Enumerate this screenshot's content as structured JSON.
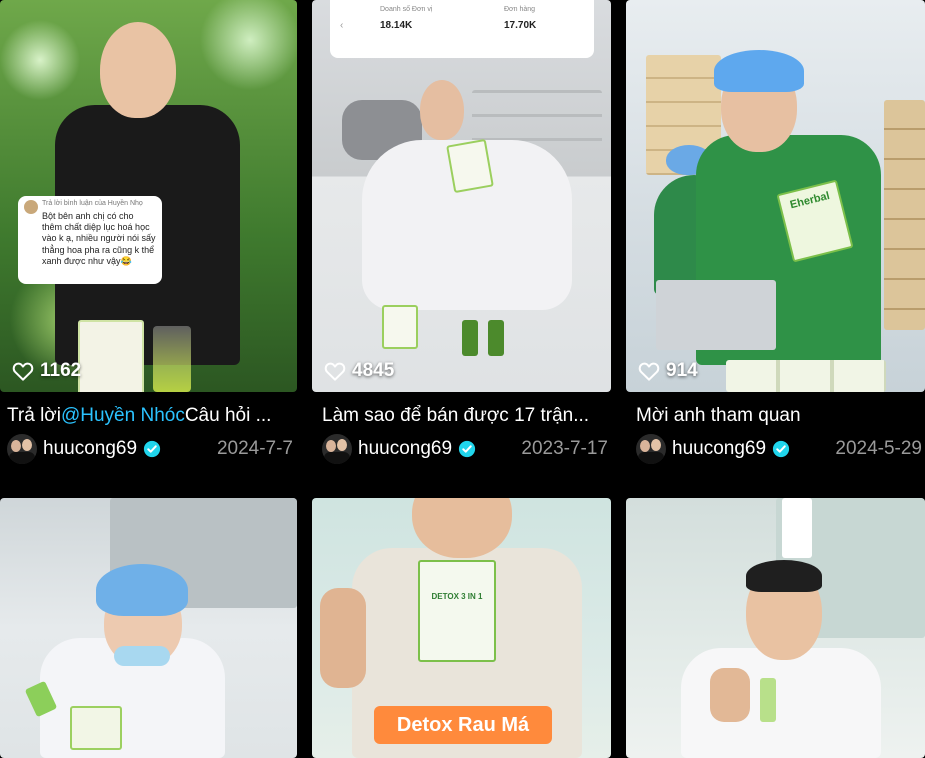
{
  "videos": [
    {
      "likes": "1162",
      "title_prefix": "Trả lời",
      "title_mention": "@Huyền Nhóc",
      "title_rest": "Câu hỏi ...",
      "author": "huucong69",
      "date": "2024-7-7",
      "overlay": {
        "header": "Trả lời bình luận của Huyền Nhọ",
        "text": "Bột bên anh chị có cho thêm chất diệp lục hoá học vào k ạ, nhiều người nói sấy thẳng hoa pha ra cũng k thể xanh được như vậy😂"
      }
    },
    {
      "likes": "4845",
      "title": "Làm sao để bán được 17 trận...",
      "author": "huucong69",
      "date": "2023-7-17",
      "overlay": {
        "label_1": "Doanh số Đơn vị",
        "value_1": "18.14K",
        "label_2": "Đơn hàng",
        "value_2": "17.70K",
        "arrow": "‹"
      }
    },
    {
      "likes": "914",
      "title": "Mời anh tham quan",
      "author": "huucong69",
      "date": "2024-5-29",
      "overlay": {
        "box_label": "Eherbal"
      }
    },
    {
      "overlay": {}
    },
    {
      "overlay": {
        "pill": "Detox Rau Má",
        "box_label": "DETOX 3 IN 1"
      }
    },
    {
      "overlay": {}
    }
  ],
  "colors": {
    "background": "#000000",
    "mention": "#2bc3ff",
    "verified": "#20d5ec",
    "date": "#9a9a9a",
    "pill": "#ff8a3c"
  },
  "icons": {
    "likes": "heart-outline-icon",
    "verified": "verified-badge-icon"
  }
}
